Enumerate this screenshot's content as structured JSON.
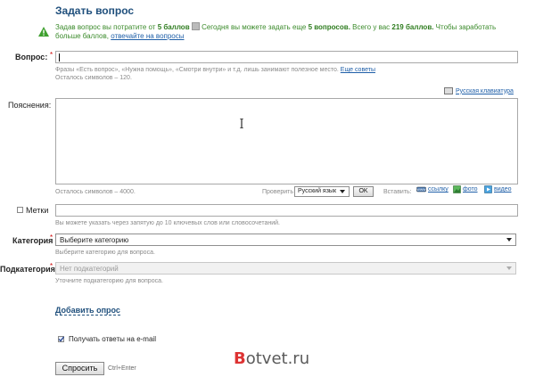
{
  "header": {
    "title": "Задать вопрос"
  },
  "notice": {
    "part1": "Задав вопрос вы потратите от ",
    "points_cost": "5 баллов",
    "part2": " Сегодня вы можете задать еще ",
    "questions_left": "5 вопросов.",
    "part3": " Всего у вас ",
    "balance": "219 баллов.",
    "part4": " Чтобы заработать больше баллов, ",
    "link": "отвечайте на вопросы"
  },
  "question": {
    "label": "Вопрос:",
    "required": "*",
    "value": "",
    "hint_line1": "Фразы «Есть вопрос», «Нужна помощь», «Смотри внутри» и т.д. лишь занимают полезное место. ",
    "hint_link": "Еще советы",
    "hint_line2": "Осталось символов – 120."
  },
  "keyboard_link": "Русская клавиатура",
  "details": {
    "label": "Пояснения:",
    "value": "",
    "chars_left": "Осталось символов – 4000.",
    "check_label": "Проверить",
    "language": "Русский язык",
    "ok_label": "OK",
    "insert_label": "Вставить:",
    "insert_link": "ссылку",
    "insert_photo": "фото",
    "insert_video": "видео"
  },
  "tags": {
    "label": "Метки",
    "value": "",
    "hint": "Вы можете указать через запятую до 10 ключевых слов или словосочетаний."
  },
  "category": {
    "label": "Категория",
    "required": "*",
    "selected": "Выберите категорию",
    "hint": "Выберите категорию для вопроса."
  },
  "subcategory": {
    "label": "Подкатегория",
    "required": "*",
    "selected": "Нет подкатегорий",
    "hint": "Уточните подкатегорию для вопроса."
  },
  "add_poll": "Добавить опрос",
  "email_notify": {
    "label": "Получать ответы на e-mail",
    "checked": true
  },
  "submit": {
    "label": "Спросить",
    "shortcut": "Ctrl+Enter"
  },
  "watermark": {
    "b": "B",
    "rest": "otvet.ru"
  },
  "colors": {
    "accent": "#1f4f7c",
    "notice_green": "#3a8a2a",
    "link": "#1f5fa8",
    "required": "#cc0000"
  }
}
